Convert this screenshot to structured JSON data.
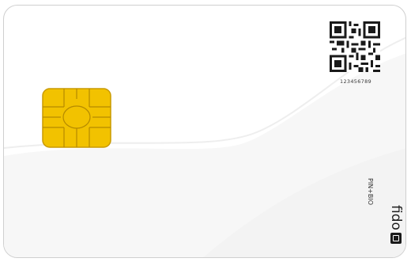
{
  "card": {
    "serial_number": "123456789",
    "pin_bio_label": "PIN+BIO",
    "brand_logo_text": "fido",
    "chip_color": "#f2c200",
    "chip_outline": "#c99a00"
  }
}
